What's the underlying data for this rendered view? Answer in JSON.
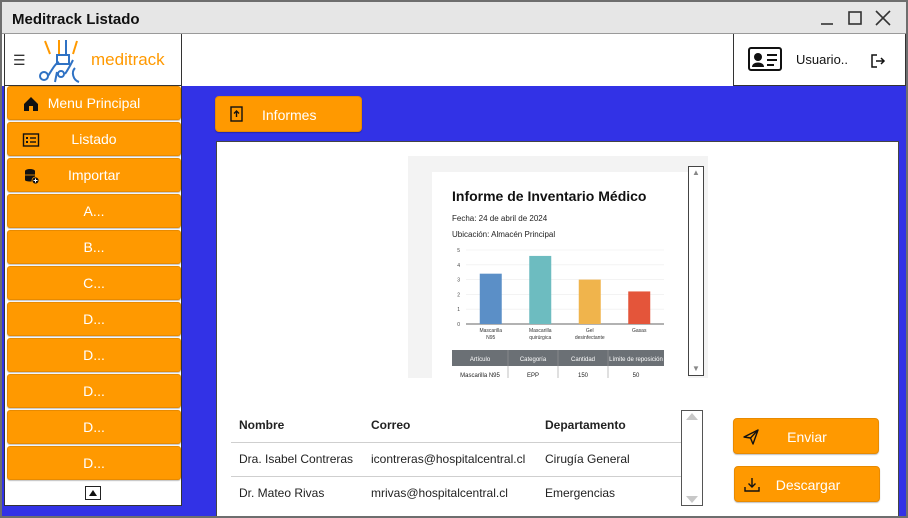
{
  "window": {
    "title": "Meditrack Listado"
  },
  "brand": {
    "name": "meditrack",
    "color": "#ff9900"
  },
  "user": {
    "name": "Usuario.."
  },
  "sidebar": {
    "items": [
      {
        "label": "Menu Principal",
        "icon": "home-icon"
      },
      {
        "label": "Listado",
        "icon": "list-icon"
      },
      {
        "label": "Importar",
        "icon": "database-add-icon"
      },
      {
        "label": "A...",
        "icon": ""
      },
      {
        "label": "B...",
        "icon": ""
      },
      {
        "label": "C...",
        "icon": ""
      },
      {
        "label": "D...",
        "icon": ""
      },
      {
        "label": "D...",
        "icon": ""
      },
      {
        "label": "D...",
        "icon": ""
      },
      {
        "label": "D...",
        "icon": ""
      },
      {
        "label": "D...",
        "icon": ""
      }
    ]
  },
  "toolbar": {
    "informes_label": "Informes"
  },
  "report": {
    "title": "Informe de Inventario Médico",
    "date_line": "Fecha: 24 de abril de 2024",
    "location_line": "Ubicación: Almacén Principal",
    "table_headers": [
      "Artículo",
      "Categoría",
      "Cantidad",
      "Límite de reposición"
    ],
    "table_row": [
      "Mascarilla N95",
      "EPP",
      "150",
      "50"
    ]
  },
  "chart_data": {
    "type": "bar",
    "title": "",
    "xlabel": "",
    "ylabel": "",
    "categories": [
      "Mascarilla N95",
      "Mascarilla quirúrgica",
      "Gel desinfectante",
      "Gasas"
    ],
    "values": [
      3.4,
      4.6,
      3.0,
      2.2
    ],
    "colors": [
      "#5b8fc7",
      "#6dbcc0",
      "#f0b44c",
      "#e4553a"
    ],
    "yticks": [
      0,
      1,
      2,
      3,
      4,
      5
    ],
    "ylim": [
      0,
      5
    ],
    "grid": true
  },
  "table": {
    "headers": [
      "Nombre",
      "Correo",
      "Departamento"
    ],
    "rows": [
      [
        "Dra. Isabel Contreras",
        "icontreras@hospitalcentral.cl",
        "Cirugía General"
      ],
      [
        "Dr. Mateo Rivas",
        "mrivas@hospitalcentral.cl",
        "Emergencias"
      ]
    ]
  },
  "actions": {
    "send_label": "Enviar",
    "download_label": "Descargar"
  },
  "colors": {
    "accent": "#ff9900",
    "background": "#3232e6"
  }
}
